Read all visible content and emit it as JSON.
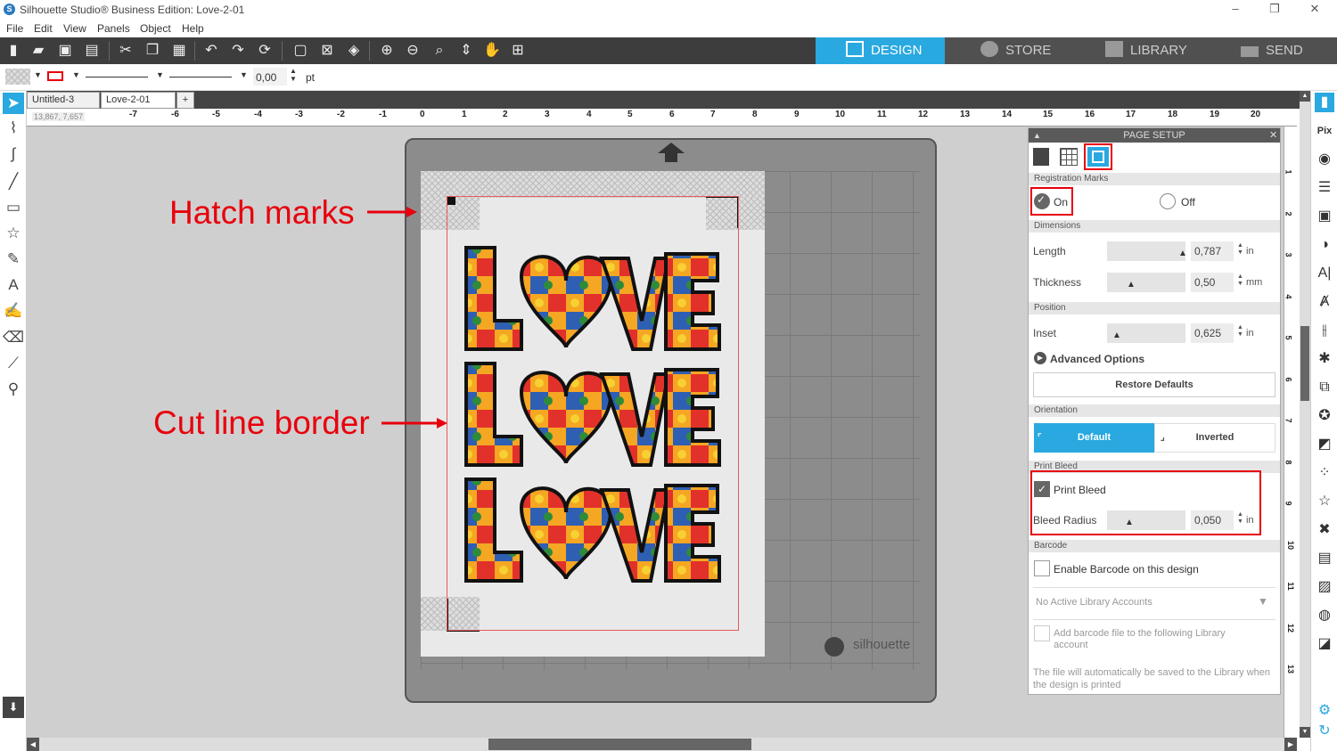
{
  "window": {
    "title": "Silhouette Studio® Business Edition: Love-2-01",
    "logo_letter": "S",
    "minimize": "–",
    "restore": "❐",
    "close": "✕"
  },
  "menu": [
    "File",
    "Edit",
    "View",
    "Panels",
    "Object",
    "Help"
  ],
  "nav_tabs": {
    "design": "DESIGN",
    "store": "STORE",
    "library": "LIBRARY",
    "send": "SEND"
  },
  "props": {
    "stroke_width": "0,00",
    "stroke_unit": "pt"
  },
  "doc_tabs": [
    {
      "label": "Untitled-3",
      "close": "×"
    },
    {
      "label": "Love-2-01",
      "close": "×"
    }
  ],
  "add_tab": "+",
  "coords": "13,867, 7,657",
  "ruler_numbers": [
    "-7",
    "-6",
    "-5",
    "-4",
    "-3",
    "-2",
    "-1",
    "0",
    "1",
    "2",
    "3",
    "4",
    "5",
    "6",
    "7",
    "8",
    "9",
    "10",
    "11",
    "12",
    "13",
    "14",
    "15",
    "16",
    "17",
    "18",
    "19",
    "20"
  ],
  "vruler_numbers": [
    "1",
    "2",
    "3",
    "4",
    "5",
    "6",
    "7",
    "8",
    "9",
    "10",
    "11",
    "12",
    "13"
  ],
  "annotations": {
    "hatch": "Hatch marks",
    "cut": "Cut line border"
  },
  "artwork": {
    "word": "LOVE"
  },
  "mat": {
    "brand": "silhouette"
  },
  "panel": {
    "title": "PAGE SETUP",
    "close": "✕",
    "registration_marks": {
      "header": "Registration Marks",
      "on": "On",
      "off": "Off",
      "selected": "On"
    },
    "dimensions": {
      "header": "Dimensions",
      "length_label": "Length",
      "length_value": "0,787",
      "length_unit": "in",
      "thickness_label": "Thickness",
      "thickness_value": "0,50",
      "thickness_unit": "mm"
    },
    "position": {
      "header": "Position",
      "inset_label": "Inset",
      "inset_value": "0,625",
      "inset_unit": "in"
    },
    "advanced_options": "Advanced Options",
    "restore_defaults": "Restore Defaults",
    "orientation": {
      "header": "Orientation",
      "default": "Default",
      "inverted": "Inverted"
    },
    "print_bleed": {
      "header": "Print Bleed",
      "checkbox_label": "Print Bleed",
      "checked": true,
      "radius_label": "Bleed Radius",
      "radius_value": "0,050",
      "radius_unit": "in"
    },
    "barcode": {
      "header": "Barcode",
      "enable_label": "Enable Barcode on this design",
      "accounts": "No Active Library Accounts",
      "add_file_label": "Add barcode file to the following Library account",
      "note": "The file will automatically be saved to the Library when the design is printed"
    }
  },
  "colors": {
    "accent": "#29a9e0",
    "annotation": "#e8000c",
    "toolbar": "#3d3d3d"
  }
}
